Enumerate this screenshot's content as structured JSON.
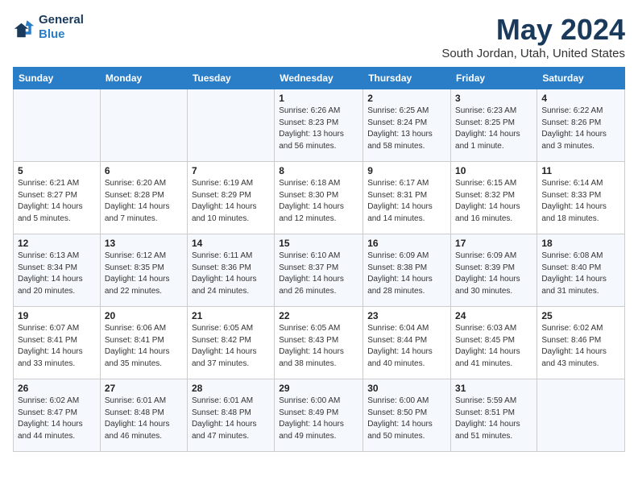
{
  "logo": {
    "line1": "General",
    "line2": "Blue"
  },
  "title": "May 2024",
  "subtitle": "South Jordan, Utah, United States",
  "days_header": [
    "Sunday",
    "Monday",
    "Tuesday",
    "Wednesday",
    "Thursday",
    "Friday",
    "Saturday"
  ],
  "weeks": [
    [
      {
        "num": "",
        "info": ""
      },
      {
        "num": "",
        "info": ""
      },
      {
        "num": "",
        "info": ""
      },
      {
        "num": "1",
        "info": "Sunrise: 6:26 AM\nSunset: 8:23 PM\nDaylight: 13 hours\nand 56 minutes."
      },
      {
        "num": "2",
        "info": "Sunrise: 6:25 AM\nSunset: 8:24 PM\nDaylight: 13 hours\nand 58 minutes."
      },
      {
        "num": "3",
        "info": "Sunrise: 6:23 AM\nSunset: 8:25 PM\nDaylight: 14 hours\nand 1 minute."
      },
      {
        "num": "4",
        "info": "Sunrise: 6:22 AM\nSunset: 8:26 PM\nDaylight: 14 hours\nand 3 minutes."
      }
    ],
    [
      {
        "num": "5",
        "info": "Sunrise: 6:21 AM\nSunset: 8:27 PM\nDaylight: 14 hours\nand 5 minutes."
      },
      {
        "num": "6",
        "info": "Sunrise: 6:20 AM\nSunset: 8:28 PM\nDaylight: 14 hours\nand 7 minutes."
      },
      {
        "num": "7",
        "info": "Sunrise: 6:19 AM\nSunset: 8:29 PM\nDaylight: 14 hours\nand 10 minutes."
      },
      {
        "num": "8",
        "info": "Sunrise: 6:18 AM\nSunset: 8:30 PM\nDaylight: 14 hours\nand 12 minutes."
      },
      {
        "num": "9",
        "info": "Sunrise: 6:17 AM\nSunset: 8:31 PM\nDaylight: 14 hours\nand 14 minutes."
      },
      {
        "num": "10",
        "info": "Sunrise: 6:15 AM\nSunset: 8:32 PM\nDaylight: 14 hours\nand 16 minutes."
      },
      {
        "num": "11",
        "info": "Sunrise: 6:14 AM\nSunset: 8:33 PM\nDaylight: 14 hours\nand 18 minutes."
      }
    ],
    [
      {
        "num": "12",
        "info": "Sunrise: 6:13 AM\nSunset: 8:34 PM\nDaylight: 14 hours\nand 20 minutes."
      },
      {
        "num": "13",
        "info": "Sunrise: 6:12 AM\nSunset: 8:35 PM\nDaylight: 14 hours\nand 22 minutes."
      },
      {
        "num": "14",
        "info": "Sunrise: 6:11 AM\nSunset: 8:36 PM\nDaylight: 14 hours\nand 24 minutes."
      },
      {
        "num": "15",
        "info": "Sunrise: 6:10 AM\nSunset: 8:37 PM\nDaylight: 14 hours\nand 26 minutes."
      },
      {
        "num": "16",
        "info": "Sunrise: 6:09 AM\nSunset: 8:38 PM\nDaylight: 14 hours\nand 28 minutes."
      },
      {
        "num": "17",
        "info": "Sunrise: 6:09 AM\nSunset: 8:39 PM\nDaylight: 14 hours\nand 30 minutes."
      },
      {
        "num": "18",
        "info": "Sunrise: 6:08 AM\nSunset: 8:40 PM\nDaylight: 14 hours\nand 31 minutes."
      }
    ],
    [
      {
        "num": "19",
        "info": "Sunrise: 6:07 AM\nSunset: 8:41 PM\nDaylight: 14 hours\nand 33 minutes."
      },
      {
        "num": "20",
        "info": "Sunrise: 6:06 AM\nSunset: 8:41 PM\nDaylight: 14 hours\nand 35 minutes."
      },
      {
        "num": "21",
        "info": "Sunrise: 6:05 AM\nSunset: 8:42 PM\nDaylight: 14 hours\nand 37 minutes."
      },
      {
        "num": "22",
        "info": "Sunrise: 6:05 AM\nSunset: 8:43 PM\nDaylight: 14 hours\nand 38 minutes."
      },
      {
        "num": "23",
        "info": "Sunrise: 6:04 AM\nSunset: 8:44 PM\nDaylight: 14 hours\nand 40 minutes."
      },
      {
        "num": "24",
        "info": "Sunrise: 6:03 AM\nSunset: 8:45 PM\nDaylight: 14 hours\nand 41 minutes."
      },
      {
        "num": "25",
        "info": "Sunrise: 6:02 AM\nSunset: 8:46 PM\nDaylight: 14 hours\nand 43 minutes."
      }
    ],
    [
      {
        "num": "26",
        "info": "Sunrise: 6:02 AM\nSunset: 8:47 PM\nDaylight: 14 hours\nand 44 minutes."
      },
      {
        "num": "27",
        "info": "Sunrise: 6:01 AM\nSunset: 8:48 PM\nDaylight: 14 hours\nand 46 minutes."
      },
      {
        "num": "28",
        "info": "Sunrise: 6:01 AM\nSunset: 8:48 PM\nDaylight: 14 hours\nand 47 minutes."
      },
      {
        "num": "29",
        "info": "Sunrise: 6:00 AM\nSunset: 8:49 PM\nDaylight: 14 hours\nand 49 minutes."
      },
      {
        "num": "30",
        "info": "Sunrise: 6:00 AM\nSunset: 8:50 PM\nDaylight: 14 hours\nand 50 minutes."
      },
      {
        "num": "31",
        "info": "Sunrise: 5:59 AM\nSunset: 8:51 PM\nDaylight: 14 hours\nand 51 minutes."
      },
      {
        "num": "",
        "info": ""
      }
    ]
  ]
}
